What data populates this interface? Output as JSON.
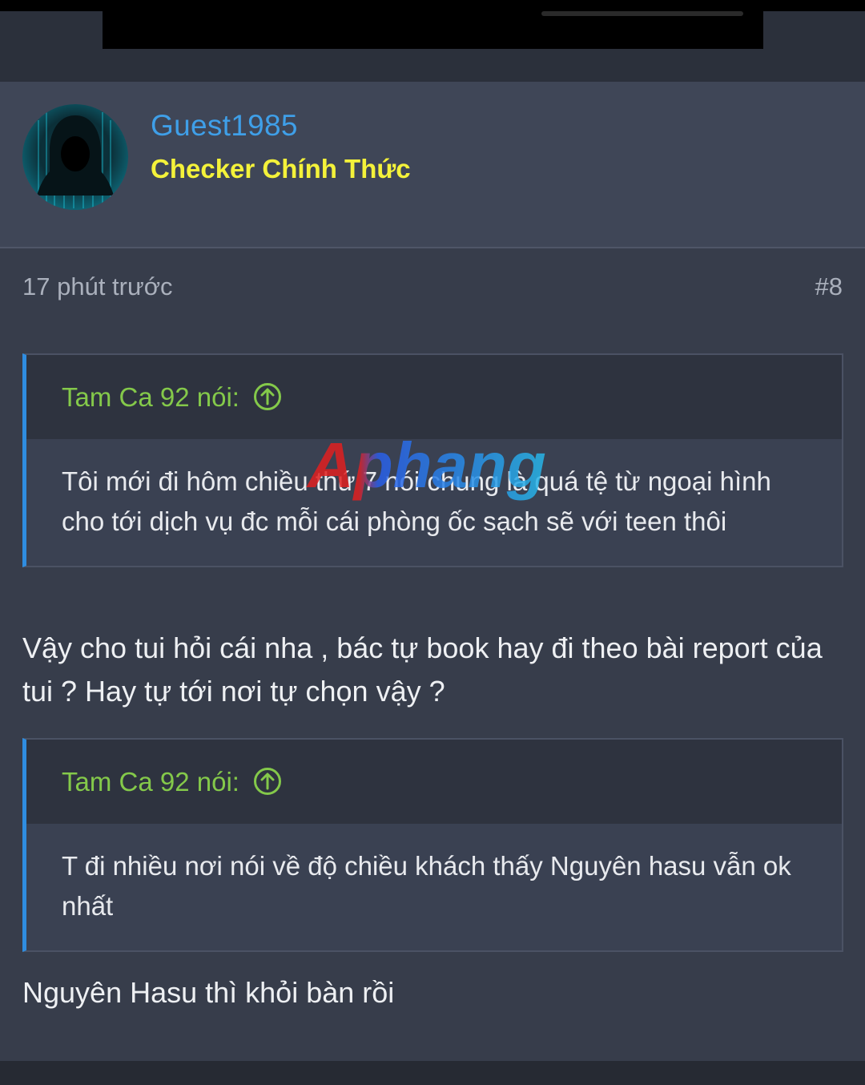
{
  "post": {
    "username": "Guest1985",
    "user_title": "Checker Chính Thức",
    "time": "17 phút trước",
    "post_number": "#8",
    "quotes": [
      {
        "author": "Tam Ca 92 nói:",
        "text": "Tôi mới đi hôm chiều thứ 7 nói chung là quá tệ từ ngoại hình cho tới dịch vụ đc mỗi cái phòng ốc sạch sẽ với teen thôi"
      },
      {
        "author": "Tam Ca 92 nói:",
        "text": "T đi nhiều nơi nói về độ chiều khách thấy Nguyên hasu vẫn ok nhất"
      }
    ],
    "replies": [
      "Vậy cho tui hỏi cái nha , bác tự book hay đi theo bài report của tui ? Hay tự tới nơi tự chọn vậy ?",
      "Nguyên Hasu thì khỏi bàn rồi"
    ]
  },
  "watermark": "Aphang",
  "icons": {
    "avatar": "hooded-hacker-avatar",
    "quote_jump": "arrow-up-circle-icon"
  },
  "colors": {
    "username": "#3f9fe8",
    "user_title": "#f4f23a",
    "quote_author": "#84c94a",
    "quote_border": "#2f8de0"
  }
}
